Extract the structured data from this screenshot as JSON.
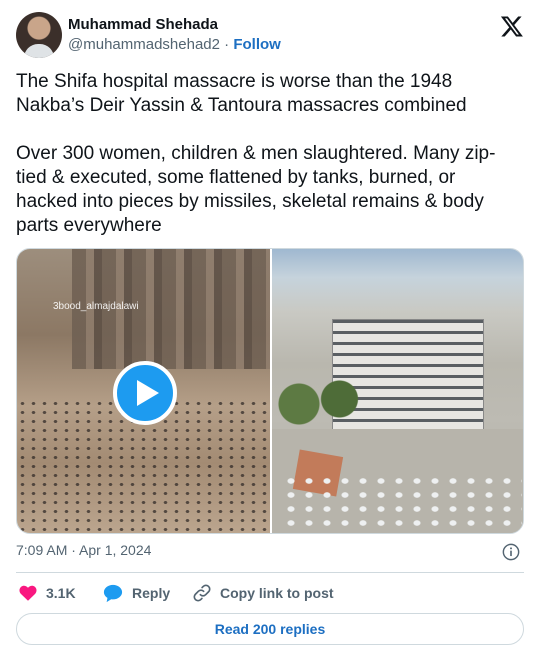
{
  "author": {
    "name": "Muhammad Shehada",
    "handle": "@muhammadshehad2",
    "separator": "·",
    "follow_label": "Follow"
  },
  "tweet": {
    "text": "The Shifa hospital massacre is worse than the 1948 Nakba’s Deir Yassin & Tantoura massacres combined\n\nOver 300 women, children & men slaughtered. Many zip-tied & executed, some flattened by tanks, burned, or hacked into pieces by missiles, skeletal remains & body parts everywhere",
    "media_watermark": "3bood_almajdalawi",
    "timestamp": "7:09 AM · Apr 1, 2024"
  },
  "actions": {
    "like_count": "3.1K",
    "reply_label": "Reply",
    "copy_label": "Copy link to post",
    "read_replies_label": "Read 200 replies"
  },
  "icons": [
    "x-logo-icon",
    "play-icon",
    "info-icon",
    "heart-icon",
    "reply-icon",
    "link-icon"
  ],
  "colors": {
    "accent": "#1d9bf0",
    "link": "#1d6fc2",
    "like": "#f91880",
    "muted": "#536471"
  }
}
